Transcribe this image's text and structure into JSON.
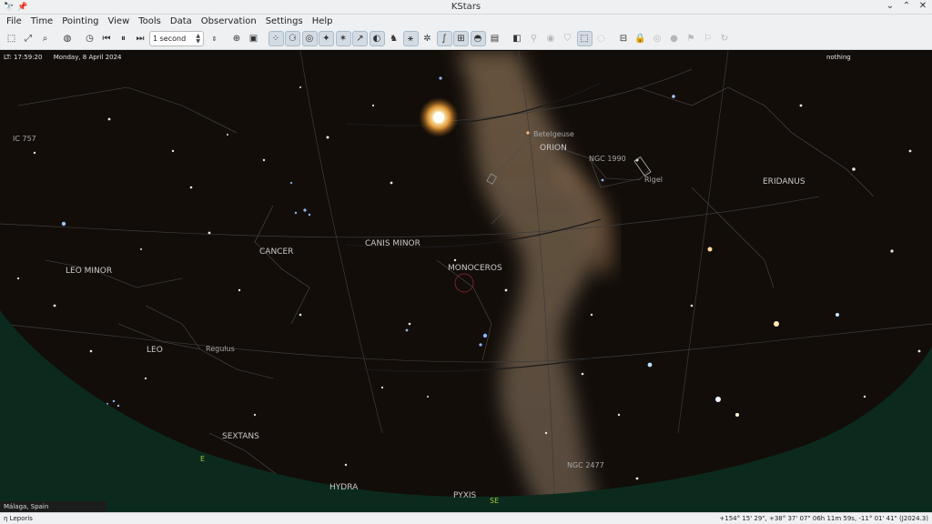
{
  "window": {
    "title": "KStars",
    "controls": {
      "minimize": "⌄",
      "maximize": "⌃",
      "close": "✕"
    }
  },
  "menu": [
    "File",
    "Time",
    "Pointing",
    "View",
    "Tools",
    "Data",
    "Observation",
    "Settings",
    "Help"
  ],
  "toolbar": {
    "time_step": "1 second",
    "icons": [
      "zoom-box-icon",
      "zoom-fit-icon",
      "search-icon",
      "globe-icon",
      "clock-icon",
      "skip-back-icon",
      "pause-icon",
      "skip-forward-icon"
    ],
    "view_icons": [
      "stars-icon",
      "deep-sky-icon",
      "galaxy-icon",
      "solar-system-icon",
      "comets-icon",
      "constellation-lines-icon",
      "milky-way-icon",
      "constellation-art-icon",
      "constellation-names-icon",
      "ecliptic-icon",
      "equator-icon",
      "grid-icon",
      "horizon-icon",
      "hips-icon",
      "observing-list-icon",
      "telescope-icon",
      "sky-culture-icon",
      "fov-icon",
      "satellite-icon",
      "symbols-icon",
      "crosshair-icon",
      "lock-icon",
      "flag-icon",
      "record-icon",
      "flag-icon-2",
      "flag-icon-3",
      "refresh-icon"
    ]
  },
  "sky": {
    "overlay": {
      "local_time": "LT: 17:59:20",
      "date": "Monday, 8 April 2024",
      "focus": "nothing",
      "location": "Málaga, Spain"
    },
    "constellations": [
      {
        "key": "orion",
        "name": "ORION"
      },
      {
        "key": "eridanus",
        "name": "ERIDANUS"
      },
      {
        "key": "cancer",
        "name": "CANCER"
      },
      {
        "key": "canis_minor",
        "name": "CANIS MINOR"
      },
      {
        "key": "monoceros",
        "name": "MONOCEROS"
      },
      {
        "key": "leo_minor",
        "name": "LEO MINOR"
      },
      {
        "key": "leo",
        "name": "LEO"
      },
      {
        "key": "sextans",
        "name": "SEXTANS"
      },
      {
        "key": "hydra",
        "name": "HYDRA"
      },
      {
        "key": "pyxis",
        "name": "PYXIS"
      }
    ],
    "objects": [
      {
        "key": "ic757",
        "name": "IC 757"
      },
      {
        "key": "betelgeuse",
        "name": "Betelgeuse"
      },
      {
        "key": "ngc1990",
        "name": "NGC 1990"
      },
      {
        "key": "rigel",
        "name": "Rigel"
      },
      {
        "key": "regulus",
        "name": "Regulus"
      },
      {
        "key": "ngc2477",
        "name": "NGC 2477"
      }
    ],
    "directions": [
      {
        "key": "e",
        "name": "E"
      },
      {
        "key": "se",
        "name": "SE"
      }
    ],
    "colors": {
      "ground": "#0b2a1d",
      "milky_way": "#7a634a",
      "sun": "#fff2c0",
      "constellation_lines": "#5a5a5a",
      "direction_label": "#a4c63a"
    }
  },
  "status": {
    "object": "η Leporis",
    "coordinates": "+154° 15' 29\", +38° 37' 07\"  06h 11m 59s, -11° 01' 41\" (J2024.3)"
  }
}
